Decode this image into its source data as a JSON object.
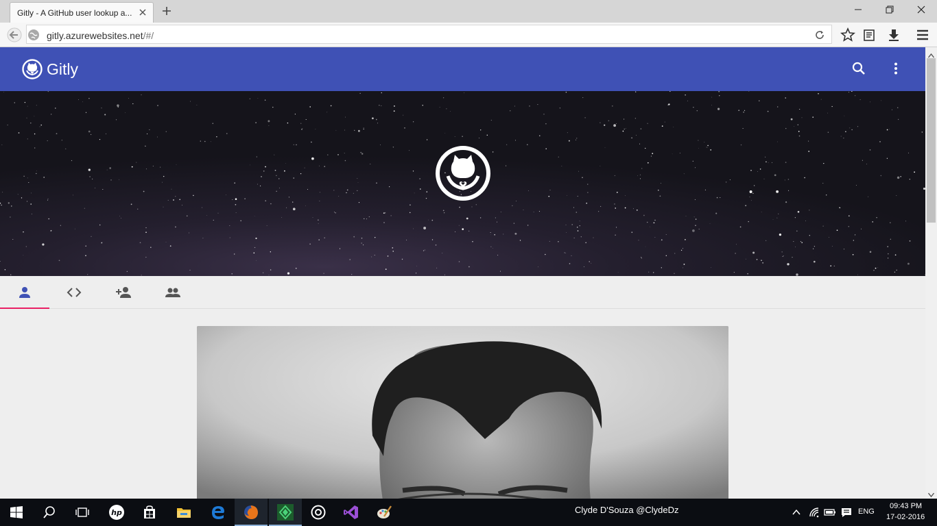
{
  "browser": {
    "tab_title": "Gitly - A GitHub user lookup a...",
    "url_host": "gitly.azurewebsites.net",
    "url_path": "/#/"
  },
  "app": {
    "title": "Gitly",
    "icons": {
      "logo": "github-octocat-heart-icon",
      "search": "search-icon",
      "more": "more-vert-icon"
    }
  },
  "profile_tabs": [
    {
      "icon": "person-icon",
      "active": true
    },
    {
      "icon": "code-icon",
      "active": false
    },
    {
      "icon": "person-add-icon",
      "active": false
    },
    {
      "icon": "group-icon",
      "active": false
    }
  ],
  "taskbar": {
    "center_text": "Clyde D'Souza @ClydeDz",
    "language": "ENG",
    "time": "09:43 PM",
    "date": "17-02-2016"
  },
  "colors": {
    "appbar": "#3f51b5",
    "tab_indicator": "#e91e63",
    "active_tab_icon": "#3f51b5"
  }
}
